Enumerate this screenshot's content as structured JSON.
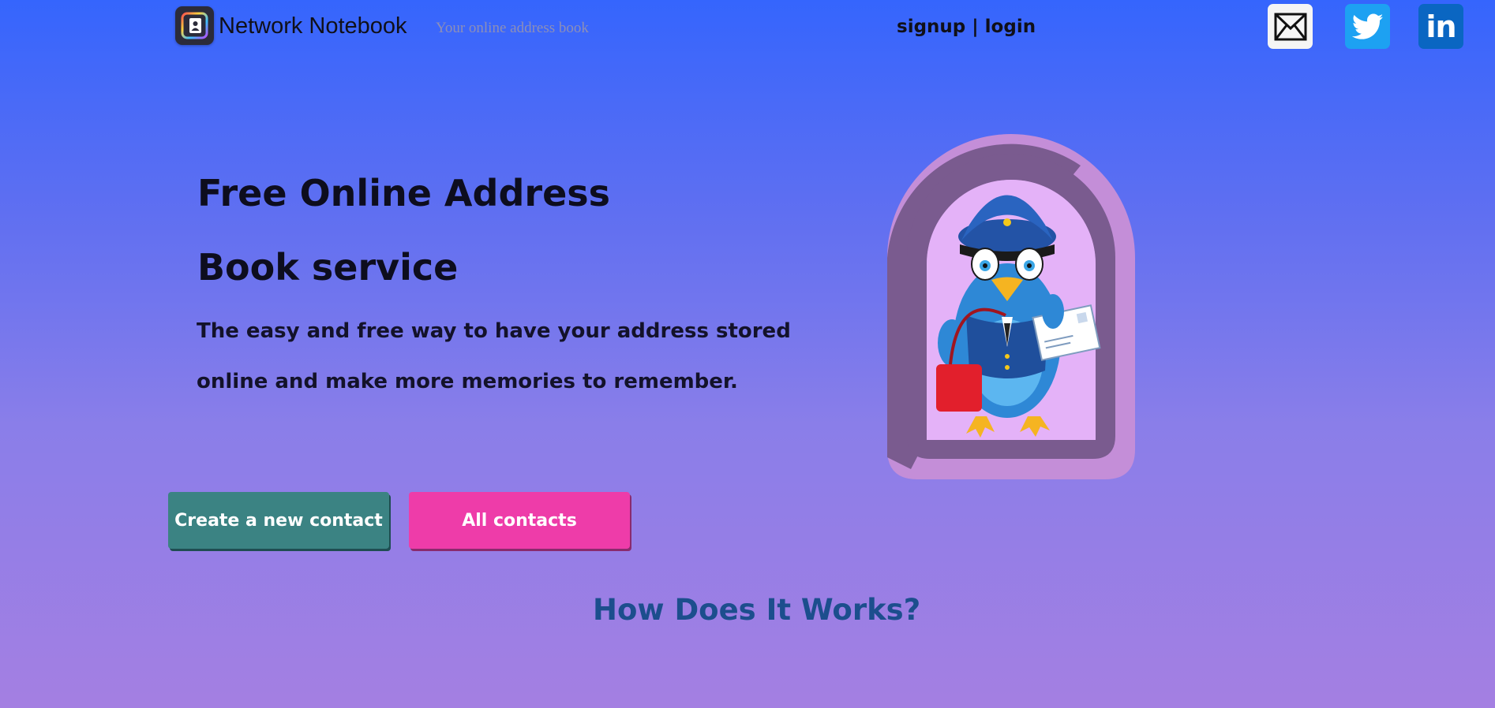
{
  "header": {
    "brand_name": "Network Notebook",
    "tagline": "Your online address book",
    "auth": {
      "signup_label": "signup",
      "separator": " | ",
      "login_label": "login"
    },
    "social": [
      {
        "name": "mail",
        "icon": "mail-icon"
      },
      {
        "name": "twitter",
        "icon": "twitter-icon"
      },
      {
        "name": "linkedin",
        "icon": "linkedin-icon",
        "glyph": "in"
      }
    ]
  },
  "hero": {
    "title": "Free Online Address Book service",
    "subtitle": "The easy and free way to have your address stored online and make more memories to remember.",
    "illustration": "mail-carrier-bird-illustration"
  },
  "actions": {
    "create_label": "Create a new contact",
    "all_label": "All contacts"
  },
  "section": {
    "how_heading": "How Does It Works?"
  },
  "colors": {
    "background_top": "#3565fd",
    "background_bottom": "#a47fe2",
    "create_button": "#3b8383",
    "all_button": "#ee3ca9",
    "heading_blue": "#1c4e8d",
    "twitter_blue": "#1da1f2",
    "linkedin_blue": "#0a66c2"
  }
}
